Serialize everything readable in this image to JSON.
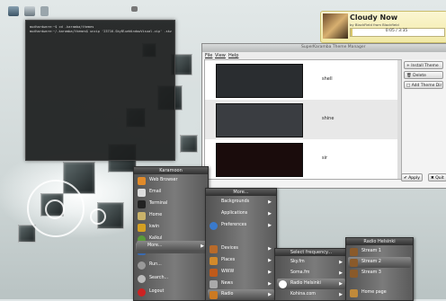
{
  "terminal": {
    "lines": [
      "mudhardware:~$ cd .karamba/themes",
      "mudhardware:~/.karamba/themes$ unzip '23716-SkyBlueWindowVisual.zip' .skz"
    ]
  },
  "player": {
    "title": "Cloudy Now",
    "artist": "by BlackField from Blackfield",
    "time": "0:05 / 3:35",
    "progress": 0.023
  },
  "theme_manager": {
    "window_title": "SuperKaramba Theme Manager",
    "menu": [
      "File",
      "View",
      "Help"
    ],
    "themes": [
      {
        "name": "shell"
      },
      {
        "name": "shine"
      },
      {
        "name": "sir"
      }
    ],
    "buttons": {
      "install": "Install Theme",
      "delete": "Delete",
      "add_dir": "Add Theme Dir",
      "apply": "Apply",
      "quit": "Quit"
    }
  },
  "karamoon_menu": {
    "title": "Karamoon",
    "items": [
      "Web Browser",
      "Email",
      "Terminal",
      "Home",
      "kwin",
      "Kalkul",
      "Kenata"
    ],
    "more": "More...",
    "bottom": [
      "Run...",
      "Search...",
      "Logout"
    ]
  },
  "more_menu": {
    "title": "More...",
    "items": [
      "Backgrounds",
      "Applications",
      "Preferences",
      "Devices",
      "Places",
      "WWW",
      "News",
      "Radio"
    ]
  },
  "freq_menu": {
    "title": "Select frequency...",
    "items": [
      "Sky.fm",
      "Soma.fm",
      "Radio Helsinki",
      "Kohina.com"
    ]
  },
  "radio_menu": {
    "title": "Radio Helsinki",
    "items": [
      "Stream 1",
      "Stream 2",
      "Stream 3",
      "Home page"
    ]
  },
  "colors": {
    "menu_dark": "#535353",
    "player_yellow": "#f1e9a6",
    "terminal_bg": "#1c1e1e"
  }
}
